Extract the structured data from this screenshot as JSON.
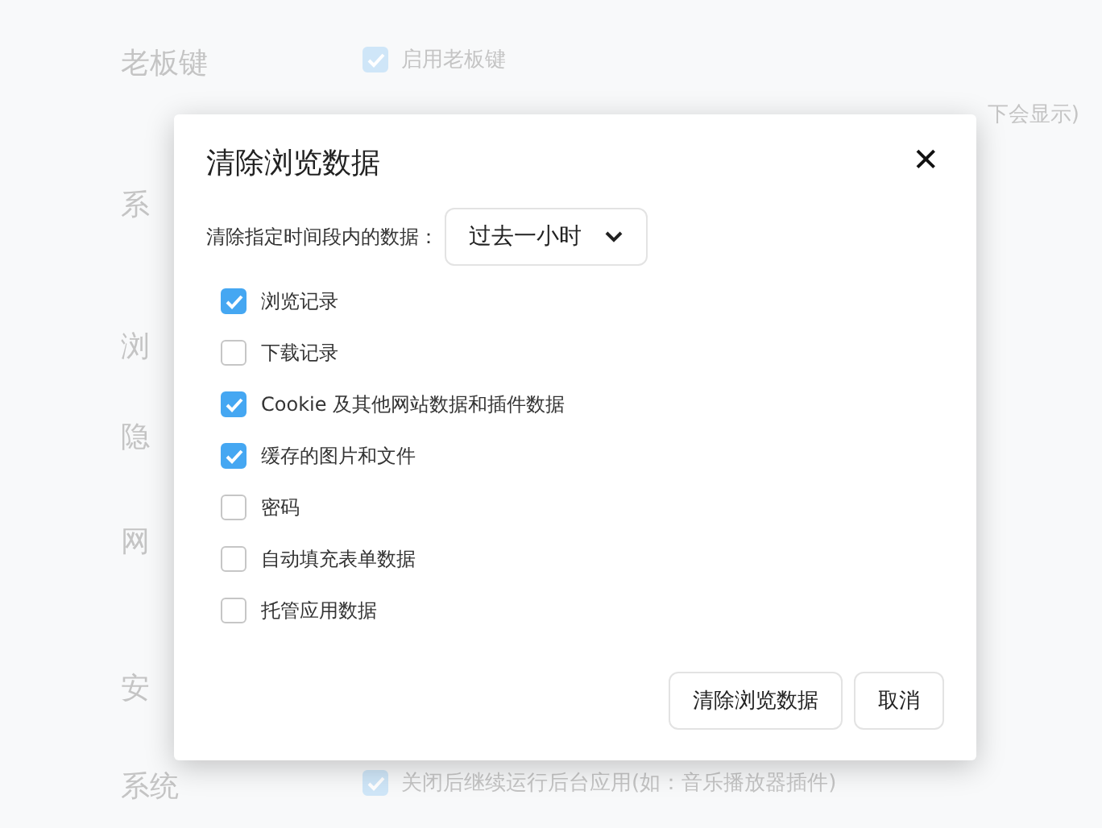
{
  "settings": {
    "sections": [
      {
        "label": "老板键",
        "options": [
          {
            "kind": "checkbox",
            "label": "启用老板键",
            "checked": true
          },
          {
            "kind": "hint",
            "label": "下会显示)"
          }
        ]
      },
      {
        "label": "系"
      },
      {
        "label": "浏"
      },
      {
        "label": "隐"
      },
      {
        "label": "网"
      },
      {
        "label": "安"
      },
      {
        "label": "系统",
        "options": [
          {
            "kind": "checkbox",
            "label": "关闭后继续运行后台应用(如：音乐播放器插件)",
            "checked": true
          }
        ]
      }
    ]
  },
  "dialog": {
    "title": "清除浏览数据",
    "close": "✕",
    "range_label": "清除指定时间段内的数据：",
    "range_value": "过去一小时",
    "items": [
      {
        "label": "浏览记录",
        "checked": true
      },
      {
        "label": "下载记录",
        "checked": false
      },
      {
        "label": "Cookie 及其他网站数据和插件数据",
        "checked": true
      },
      {
        "label": "缓存的图片和文件",
        "checked": true
      },
      {
        "label": "密码",
        "checked": false
      },
      {
        "label": "自动填充表单数据",
        "checked": false
      },
      {
        "label": "托管应用数据",
        "checked": false
      }
    ],
    "buttons": [
      "清除浏览数据",
      "取消"
    ]
  }
}
